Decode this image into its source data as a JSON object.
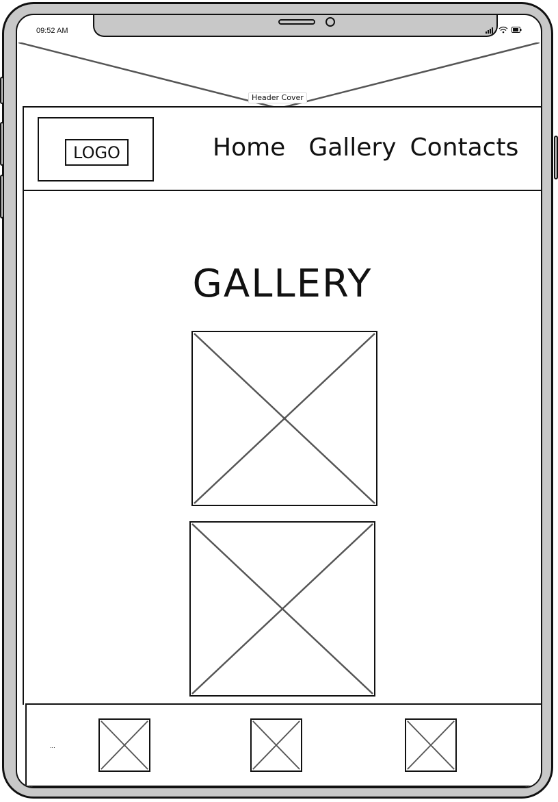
{
  "status_bar": {
    "time": "09:52 AM"
  },
  "header_cover": {
    "label": "Header Cover"
  },
  "navbar": {
    "logo": "LOGO",
    "links": [
      "Home",
      "Gallery",
      "Contacts"
    ]
  },
  "main": {
    "title": "GALLERY"
  },
  "footer": {
    "text": "..."
  },
  "icons": {
    "signal": "signal-icon",
    "wifi": "wifi-icon",
    "battery": "battery-icon",
    "image_placeholder": "image-placeholder-icon"
  },
  "colors": {
    "frame": "#c8c8c8",
    "stroke": "#111111",
    "placeholder_lines": "#555555"
  }
}
